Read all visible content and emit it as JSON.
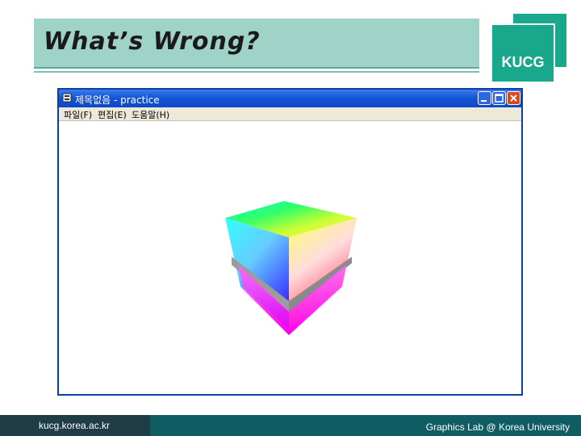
{
  "slide": {
    "title": "What’s Wrong?",
    "logo": "KUCG",
    "footer_url": "kucg.korea.ac.kr",
    "footer_credit": "Graphics Lab @ Korea University"
  },
  "window": {
    "title": "제목없음 - practice",
    "app_icon": "application-icon",
    "menu": [
      "파일(F)",
      "편집(E)",
      "도움말(H)"
    ],
    "controls": [
      "minimize-icon",
      "maximize-icon",
      "close-icon"
    ]
  },
  "colors": {
    "title_band": "#9fd3c7",
    "logo": "#1aa88c",
    "footer": "#0f5c63",
    "titlebar": "#1456d4"
  }
}
